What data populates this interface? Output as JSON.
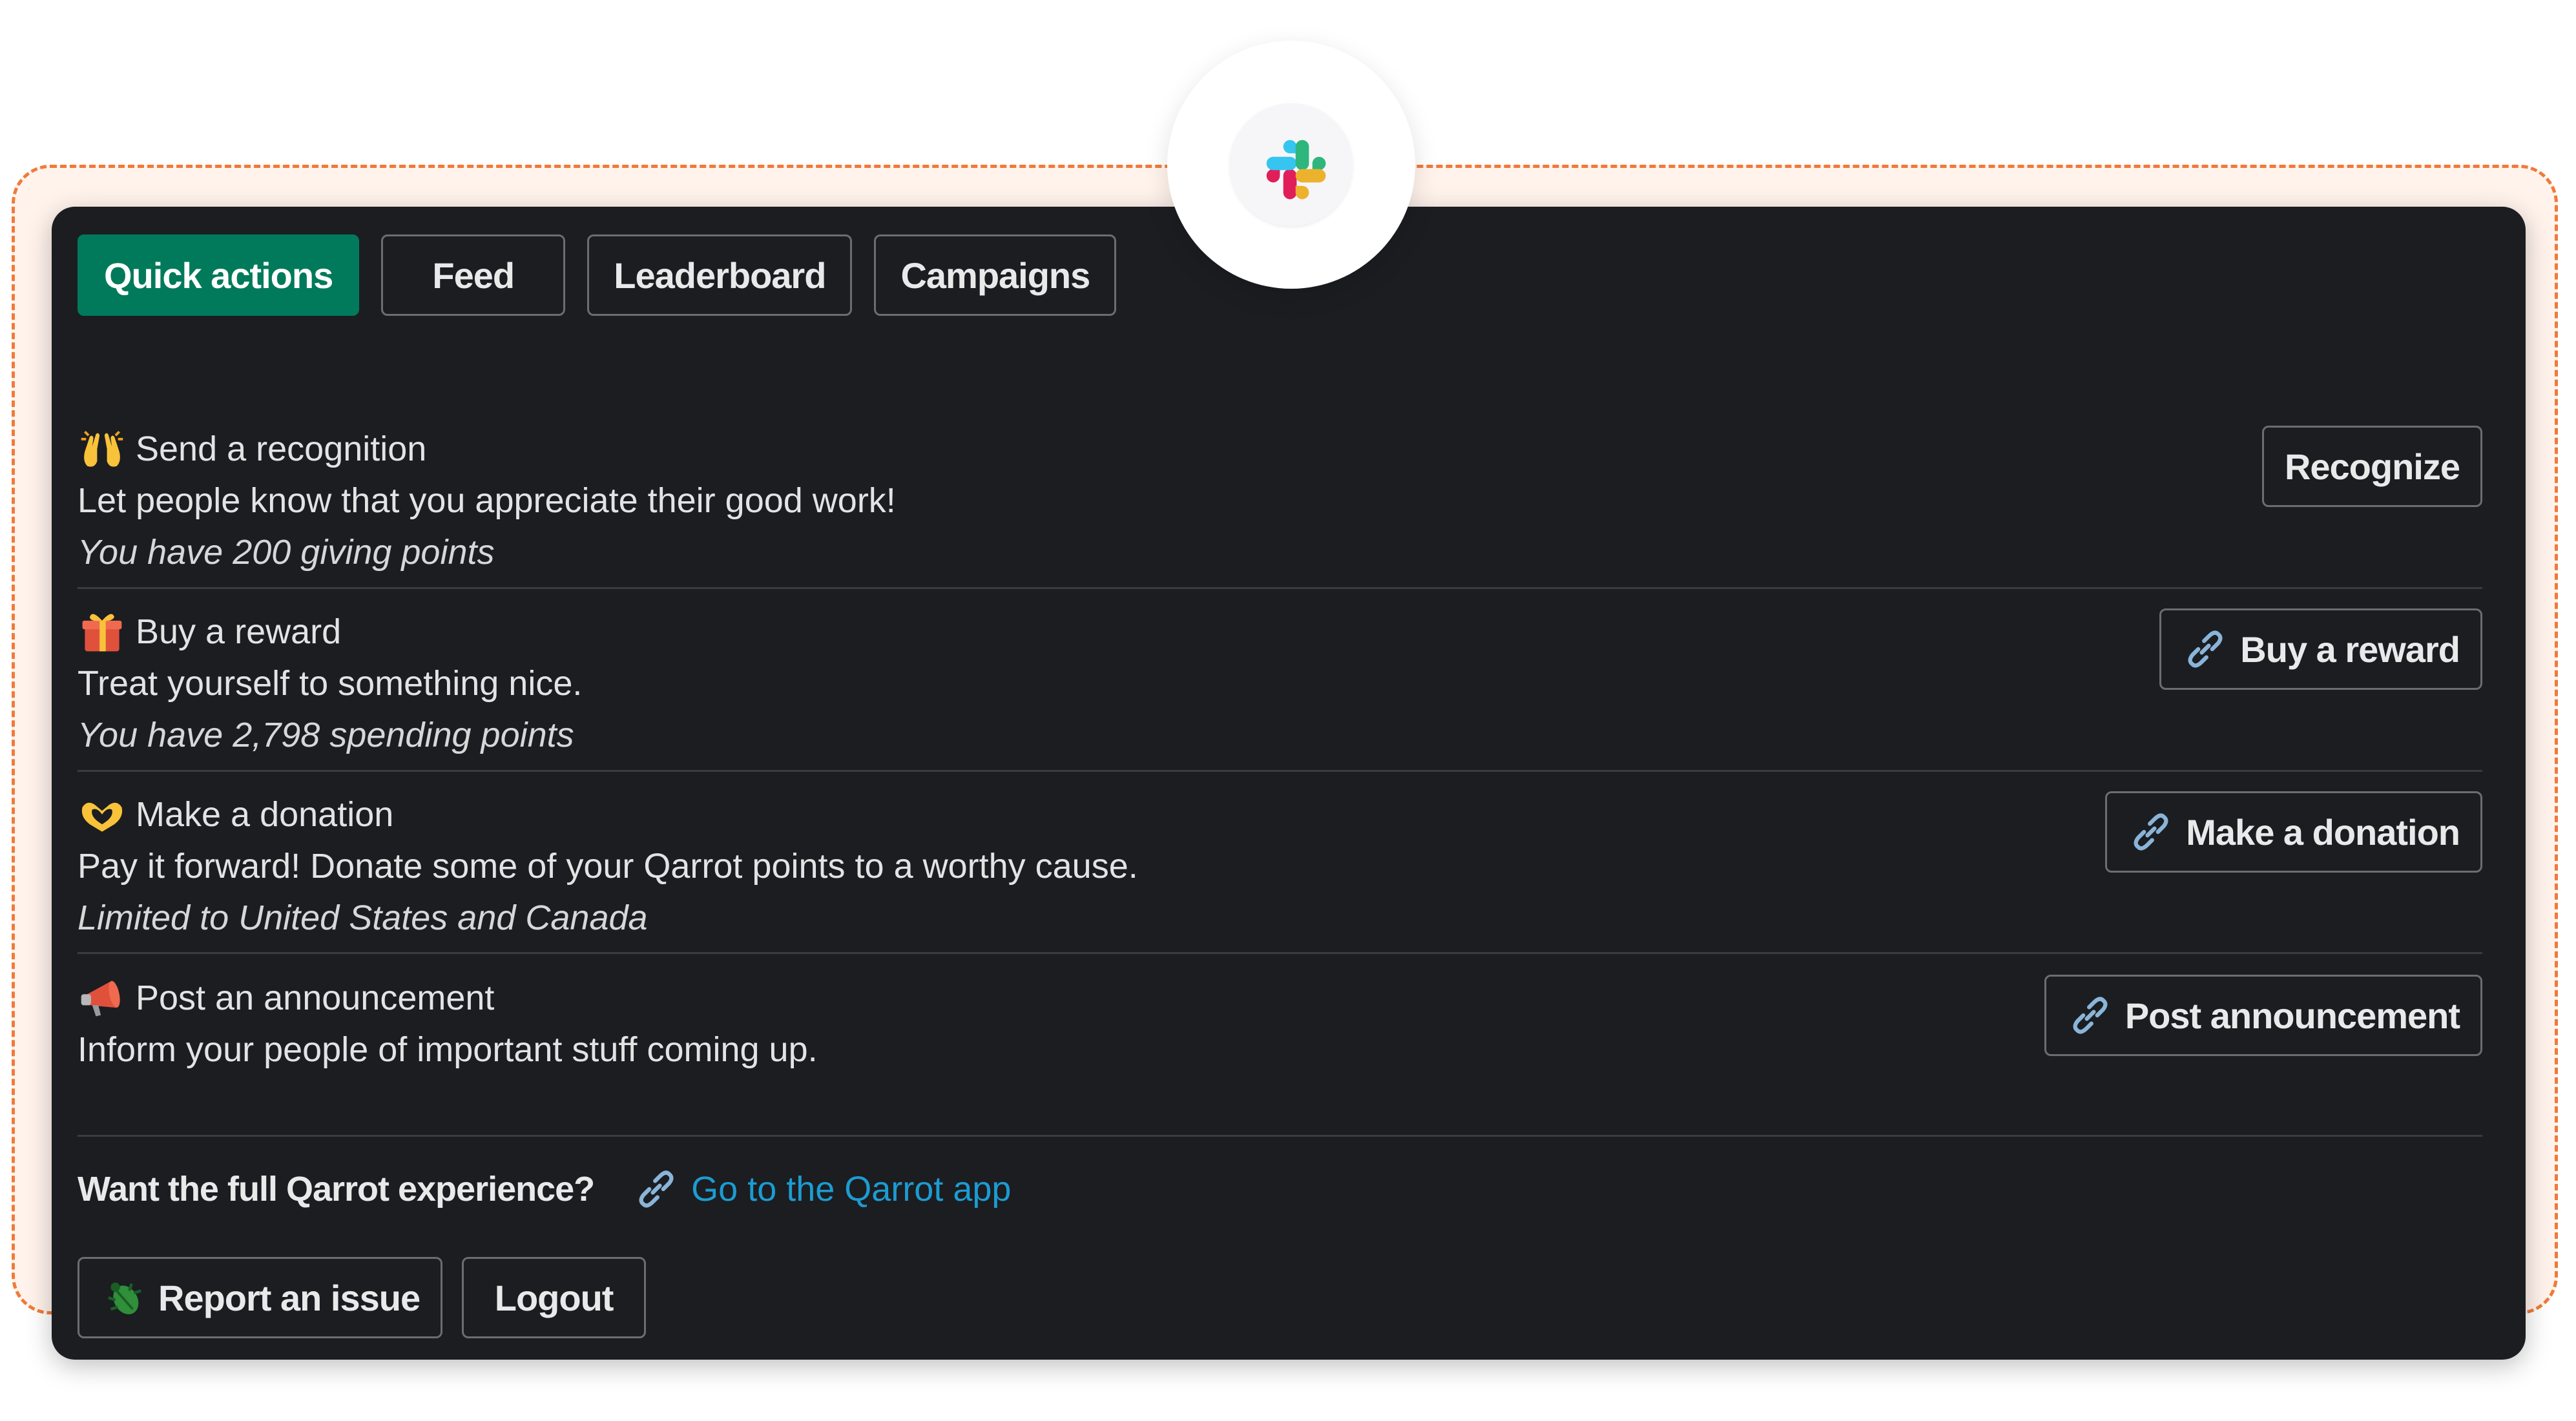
{
  "tabs": [
    {
      "label": "Quick actions",
      "active": true
    },
    {
      "label": "Feed",
      "active": false
    },
    {
      "label": "Leaderboard",
      "active": false
    },
    {
      "label": "Campaigns",
      "active": false
    }
  ],
  "actions": [
    {
      "icon": "raised-hands-icon",
      "title": "Send a recognition",
      "description": "Let people know that you appreciate their good work!",
      "note": "You have 200 giving points",
      "button": "Recognize",
      "button_icon": ""
    },
    {
      "icon": "gift-icon",
      "title": "Buy a reward",
      "description": "Treat yourself to something nice.",
      "note": "You have 2,798 spending points",
      "button": "Buy a reward",
      "button_icon": "link-icon"
    },
    {
      "icon": "heart-hands-icon",
      "title": "Make a donation",
      "description": "Pay it forward! Donate some of your Qarrot points to a worthy cause.",
      "note": "Limited to United States and Canada",
      "button": "Make a donation",
      "button_icon": "link-icon"
    },
    {
      "icon": "megaphone-icon",
      "title": "Post an announcement",
      "description": "Inform your people of important stuff coming up.",
      "note": "",
      "button": "Post announcement",
      "button_icon": "link-icon"
    }
  ],
  "footer": {
    "question": "Want the full Qarrot experience?",
    "app_link": "Go to the Qarrot app",
    "report_button": "Report an issue",
    "logout_button": "Logout"
  },
  "colors": {
    "accent": "#007a5a",
    "panel": "#1b1d21",
    "link": "#1d9bd1",
    "frame": "#f07a3a"
  }
}
